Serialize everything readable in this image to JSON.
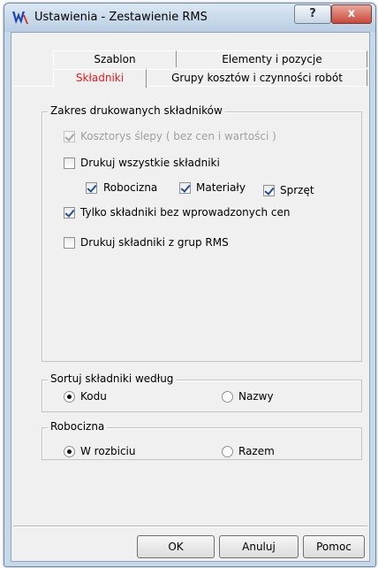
{
  "window": {
    "title": "Ustawienia - Zestawienie RMS",
    "help_label": "?",
    "close_label": "x"
  },
  "tabs": {
    "szablon": "Szablon",
    "elementy": "Elementy i pozycje",
    "skladniki": "Składniki",
    "grupy": "Grupy kosztów i czynności robót",
    "active": "Składniki"
  },
  "zakres": {
    "label": "Zakres drukowanych składników",
    "kosztorys_slepy": {
      "label": "Kosztorys ślepy ( bez cen i wartości )",
      "checked": true,
      "enabled": false
    },
    "drukuj_wszystkie": {
      "label": "Drukuj wszystkie składniki",
      "checked": false
    },
    "robocizna": {
      "label": "Robocizna",
      "checked": true
    },
    "materialy": {
      "label": "Materiały",
      "checked": true
    },
    "sprzet": {
      "label": "Sprzęt",
      "checked": true
    },
    "tylko_bez_cen": {
      "label": "Tylko składniki bez wprowadzonych cen",
      "checked": true
    },
    "z_grup_rms": {
      "label": "Drukuj składniki z grup RMS",
      "checked": false
    }
  },
  "sortuj": {
    "label": "Sortuj składniki według",
    "kodu": "Kodu",
    "nazwy": "Nazwy",
    "selected": "Kodu"
  },
  "robocizna_group": {
    "label": "Robocizna",
    "w_rozbiciu": "W rozbiciu",
    "razem": "Razem",
    "selected": "W rozbiciu"
  },
  "buttons": {
    "ok": "OK",
    "anuluj": "Anuluj",
    "pomoc": "Pomoc"
  },
  "colors": {
    "active_tab_text": "#e81a1a",
    "check_mark": "#1c4d9e",
    "title_bar": "#c7d8ea",
    "close_button": "#c9483a"
  }
}
